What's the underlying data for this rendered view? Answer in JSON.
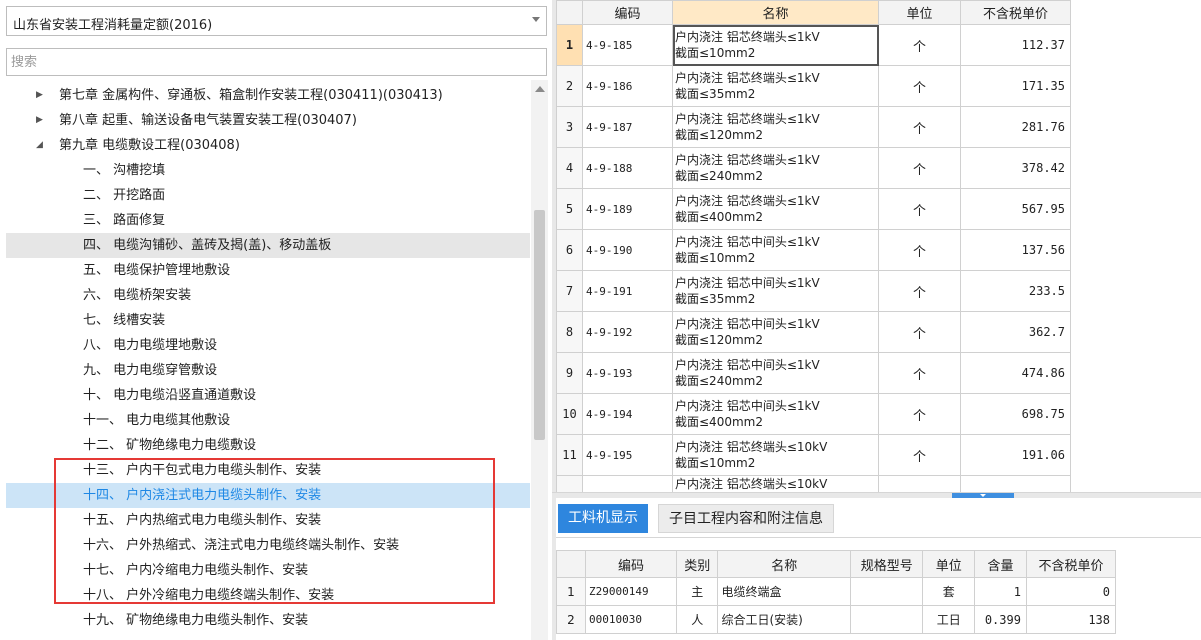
{
  "library_select": {
    "value": "山东省安装工程消耗量定额(2016)"
  },
  "search": {
    "placeholder": "搜索"
  },
  "tree": {
    "chapters": [
      {
        "label": "第七章 金属构件、穿通板、箱盒制作安装工程(030411)(030413)",
        "expanded": false
      },
      {
        "label": "第八章 起重、输送设备电气装置安装工程(030407)",
        "expanded": false
      },
      {
        "label": "第九章 电缆敷设工程(030408)",
        "expanded": true
      }
    ],
    "children": [
      "一、 沟槽挖填",
      "二、 开挖路面",
      "三、 路面修复",
      "四、 电缆沟铺砂、盖砖及揭(盖)、移动盖板",
      "五、 电缆保护管埋地敷设",
      "六、 电缆桥架安装",
      "七、 线槽安装",
      "八、 电力电缆埋地敷设",
      "九、 电力电缆穿管敷设",
      "十、 电力电缆沿竖直通道敷设",
      "十一、 电力电缆其他敷设",
      "十二、 矿物绝缘电力电缆敷设",
      "十三、 户内干包式电力电缆头制作、安装",
      "十四、 户内浇注式电力电缆头制作、安装",
      "十五、 户内热缩式电力电缆头制作、安装",
      "十六、 户外热缩式、浇注式电力电缆终端头制作、安装",
      "十七、 户内冷缩电力电缆头制作、安装",
      "十八、 户外冷缩电力电缆终端头制作、安装",
      "十九、 矿物绝缘电力电缆头制作、安装"
    ],
    "hover_index": 3,
    "selected_index": 13
  },
  "quota_table": {
    "headers": {
      "code": "编码",
      "name": "名称",
      "unit": "单位",
      "price": "不含税单价"
    },
    "rows": [
      {
        "idx": "1",
        "code": "4-9-185",
        "name1": "户内浇注 铝芯终端头≤1kV",
        "name2": "截面≤10mm2",
        "unit": "个",
        "price": "112.37"
      },
      {
        "idx": "2",
        "code": "4-9-186",
        "name1": "户内浇注 铝芯终端头≤1kV",
        "name2": "截面≤35mm2",
        "unit": "个",
        "price": "171.35"
      },
      {
        "idx": "3",
        "code": "4-9-187",
        "name1": "户内浇注 铝芯终端头≤1kV",
        "name2": "截面≤120mm2",
        "unit": "个",
        "price": "281.76"
      },
      {
        "idx": "4",
        "code": "4-9-188",
        "name1": "户内浇注 铝芯终端头≤1kV",
        "name2": "截面≤240mm2",
        "unit": "个",
        "price": "378.42"
      },
      {
        "idx": "5",
        "code": "4-9-189",
        "name1": "户内浇注 铝芯终端头≤1kV",
        "name2": "截面≤400mm2",
        "unit": "个",
        "price": "567.95"
      },
      {
        "idx": "6",
        "code": "4-9-190",
        "name1": "户内浇注 铝芯中间头≤1kV",
        "name2": "截面≤10mm2",
        "unit": "个",
        "price": "137.56"
      },
      {
        "idx": "7",
        "code": "4-9-191",
        "name1": "户内浇注 铝芯中间头≤1kV",
        "name2": "截面≤35mm2",
        "unit": "个",
        "price": "233.5"
      },
      {
        "idx": "8",
        "code": "4-9-192",
        "name1": "户内浇注 铝芯中间头≤1kV",
        "name2": "截面≤120mm2",
        "unit": "个",
        "price": "362.7"
      },
      {
        "idx": "9",
        "code": "4-9-193",
        "name1": "户内浇注 铝芯中间头≤1kV",
        "name2": "截面≤240mm2",
        "unit": "个",
        "price": "474.86"
      },
      {
        "idx": "10",
        "code": "4-9-194",
        "name1": "户内浇注 铝芯中间头≤1kV",
        "name2": "截面≤400mm2",
        "unit": "个",
        "price": "698.75"
      },
      {
        "idx": "11",
        "code": "4-9-195",
        "name1": "户内浇注 铝芯终端头≤10kV",
        "name2": "截面≤10mm2",
        "unit": "个",
        "price": "191.06"
      },
      {
        "idx": "",
        "code": "",
        "name1": "户内浇注 铝芯终端头≤10kV",
        "name2": "",
        "unit": "",
        "price": ""
      }
    ]
  },
  "tabs": {
    "active": "工料机显示",
    "inactive": "子目工程内容和附注信息"
  },
  "resource_table": {
    "headers": {
      "code": "编码",
      "type": "类别",
      "name": "名称",
      "spec": "规格型号",
      "unit": "单位",
      "qty": "含量",
      "price": "不含税单价"
    },
    "rows": [
      {
        "idx": "1",
        "code": "Z29000149",
        "type": "主",
        "name": "电缆终端盒",
        "spec": "",
        "unit": "套",
        "qty": "1",
        "price": "0"
      },
      {
        "idx": "2",
        "code": "00010030",
        "type": "人",
        "name": "综合工日(安装)",
        "spec": "",
        "unit": "工日",
        "qty": "0.399",
        "price": "138"
      }
    ]
  }
}
